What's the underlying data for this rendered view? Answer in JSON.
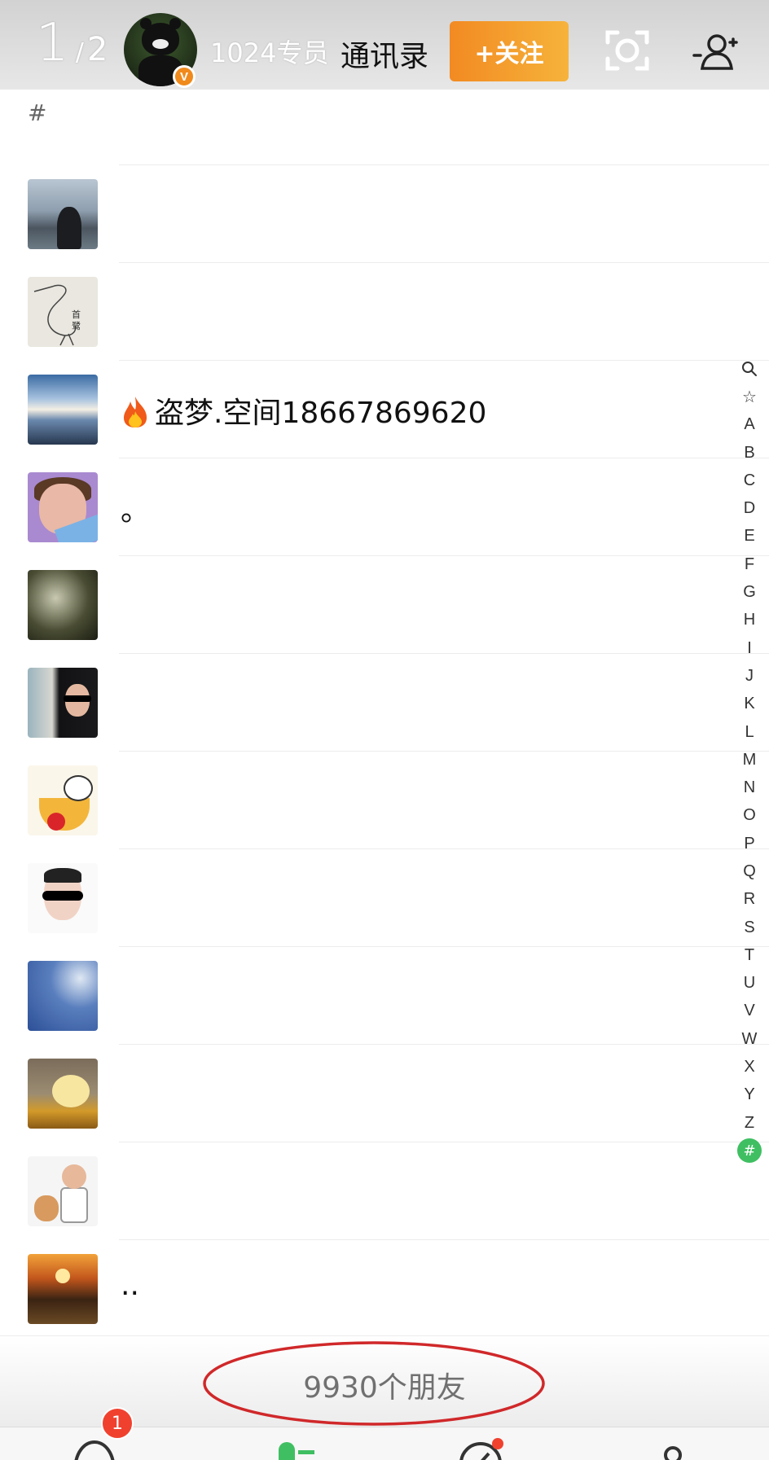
{
  "header": {
    "page_current": "1",
    "page_separator": "/",
    "page_total": "2",
    "user_name": "1024专员",
    "verified_badge": "V",
    "tab_title": "通讯录",
    "follow_button": "+关注",
    "icons": [
      "scan-icon",
      "add-friend-icon"
    ]
  },
  "section_label": "#",
  "contacts": [
    {
      "name": "",
      "avatar": "person-by-lake"
    },
    {
      "name": "",
      "avatar": "heron-drawing"
    },
    {
      "name": "盗梦.空间18667869620",
      "prefix_icon": "fire-icon",
      "avatar": "clouds-road"
    },
    {
      "name": "。",
      "avatar": "cartoon-man"
    },
    {
      "name": "",
      "avatar": "dark-texture"
    },
    {
      "name": "",
      "avatar": "man-sunglasses"
    },
    {
      "name": "",
      "avatar": "dog-in-teacup"
    },
    {
      "name": "",
      "avatar": "man-sunglasses-portrait"
    },
    {
      "name": "",
      "avatar": "blue-sky"
    },
    {
      "name": "",
      "avatar": "pompompurin"
    },
    {
      "name": "",
      "avatar": "boy-with-bear"
    },
    {
      "name": "..",
      "avatar": "sunset"
    }
  ],
  "alpha_index": [
    "🔍",
    "☆",
    "A",
    "B",
    "C",
    "D",
    "E",
    "F",
    "G",
    "H",
    "I",
    "J",
    "K",
    "L",
    "M",
    "N",
    "O",
    "P",
    "Q",
    "R",
    "S",
    "T",
    "U",
    "V",
    "W",
    "X",
    "Y",
    "Z"
  ],
  "alpha_active": "#",
  "footer": {
    "friend_count": "9930个朋友"
  },
  "tabbar": {
    "message_badge": "1"
  },
  "colors": {
    "accent_orange": "#f28a22",
    "index_active": "#3fbf62",
    "badge_red": "#f0412f",
    "annotation_red": "#d0282a"
  }
}
